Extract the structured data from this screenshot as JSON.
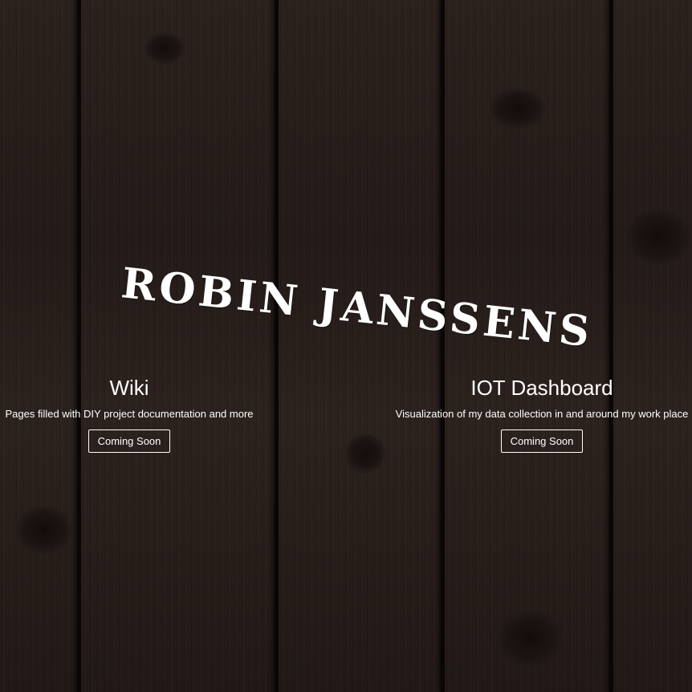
{
  "header": {
    "title": "ROBIN JANSSENS"
  },
  "cards": [
    {
      "title": "Wiki",
      "description": "Pages filled with DIY project documentation and more",
      "button_label": "Coming Soon"
    },
    {
      "title": "IOT Dashboard",
      "description": "Visualization of my data collection in and around my work place",
      "button_label": "Coming Soon"
    }
  ],
  "colors": {
    "text": "#ffffff",
    "background": "#241c19",
    "plank_gap": "#080606"
  }
}
